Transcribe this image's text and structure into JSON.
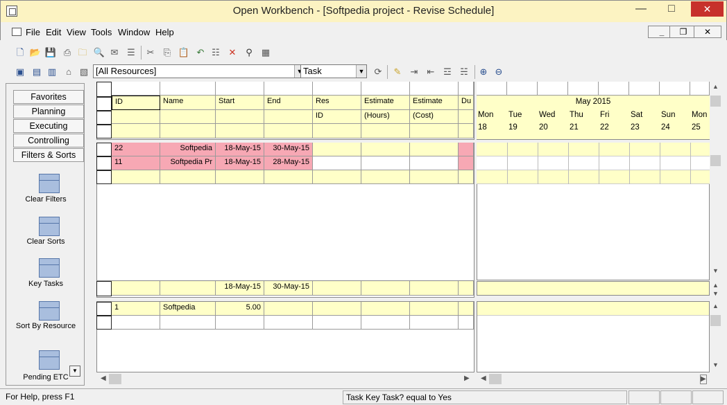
{
  "window": {
    "title": "Open Workbench - [Softpedia project - Revise Schedule]"
  },
  "menu": [
    "File",
    "Edit",
    "View",
    "Tools",
    "Window",
    "Help"
  ],
  "toolbar": {
    "resource_filter": "[All Resources]",
    "view_type": "Task"
  },
  "left_panel": {
    "groups": [
      "Favorites",
      "Planning",
      "Executing",
      "Controlling",
      "Filters & Sorts"
    ],
    "items": [
      "Clear Filters",
      "Clear Sorts",
      "Key Tasks",
      "Sort By Resource",
      "Pending ETC"
    ]
  },
  "grid": {
    "headers_row1": [
      "ID",
      "Name",
      "Start",
      "End",
      "Res",
      "Estimate",
      "Estimate",
      "Du"
    ],
    "headers_row2": [
      "",
      "",
      "",
      "",
      "ID",
      "(Hours)",
      "(Cost)",
      ""
    ],
    "rows": [
      {
        "id": "22",
        "name": "Softpedia",
        "start": "18-May-15",
        "end": "30-May-15"
      },
      {
        "id": "11",
        "name": "Softpedia Pr",
        "start": "18-May-15",
        "end": "28-May-15"
      }
    ],
    "summary": {
      "start": "18-May-15",
      "end": "30-May-15"
    },
    "resource_rows": [
      {
        "id": "1",
        "name": "Softpedia",
        "value": "5.00"
      }
    ]
  },
  "gantt": {
    "month": "May 2015",
    "days": [
      {
        "name": "Mon",
        "num": "18"
      },
      {
        "name": "Tue",
        "num": "19"
      },
      {
        "name": "Wed",
        "num": "20"
      },
      {
        "name": "Thu",
        "num": "21"
      },
      {
        "name": "Fri",
        "num": "22"
      },
      {
        "name": "Sat",
        "num": "23"
      },
      {
        "name": "Sun",
        "num": "24"
      },
      {
        "name": "Mon",
        "num": "25"
      }
    ]
  },
  "status": {
    "help": "For Help, press F1",
    "filter": "Task Key Task? equal to Yes"
  }
}
